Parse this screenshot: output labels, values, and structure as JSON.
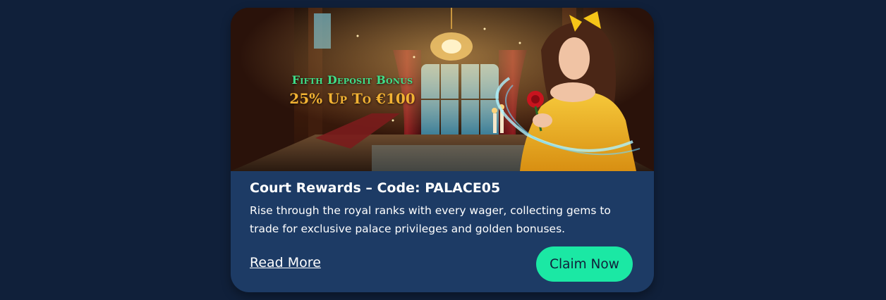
{
  "banner": {
    "promo_line1": "Fifth Deposit Bonus",
    "promo_line2": "25% Up To €100",
    "image": "ballroom-princess-with-rose"
  },
  "promo": {
    "title": "Court Rewards – Code: PALACE05",
    "description": "Rise through the royal ranks with every wager, collecting gems to trade for exclusive palace privileges and golden bonuses."
  },
  "actions": {
    "read_more": "Read More",
    "claim": "Claim Now"
  },
  "colors": {
    "page_bg": "#10203a",
    "card_bg": "#1d3b65",
    "accent": "#1be8a4",
    "promo_green": "#3fe08a",
    "promo_gold": "#f2b233"
  }
}
